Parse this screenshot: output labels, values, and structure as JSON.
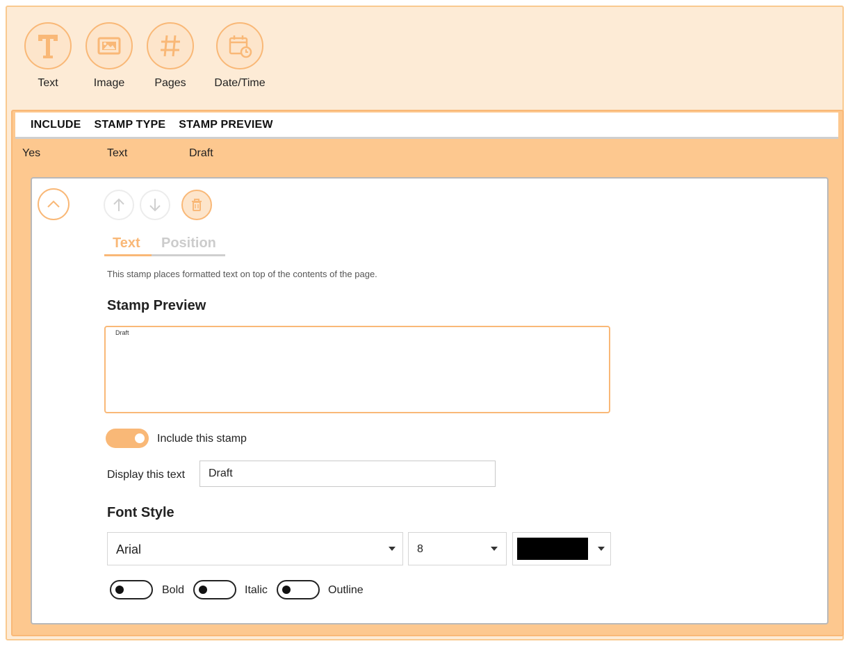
{
  "toolbar": {
    "items": [
      {
        "label": "Text",
        "icon": "text-icon"
      },
      {
        "label": "Image",
        "icon": "image-icon"
      },
      {
        "label": "Pages",
        "icon": "hash-icon"
      },
      {
        "label": "Date/Time",
        "icon": "calendar-clock-icon"
      }
    ]
  },
  "grid": {
    "columns": [
      "INCLUDE",
      "STAMP TYPE",
      "STAMP PREVIEW"
    ],
    "rows": [
      {
        "include": "Yes",
        "type": "Text",
        "preview": "Draft"
      }
    ]
  },
  "editor": {
    "tabs": [
      "Text",
      "Position"
    ],
    "active_tab": "Text",
    "description": "This stamp places formatted text on top of the contents of the page.",
    "preview_title": "Stamp Preview",
    "preview_text": "Draft",
    "include_label": "Include this stamp",
    "include_on": true,
    "display_label": "Display this text",
    "display_value": "Draft",
    "font_title": "Font Style",
    "font_family": "Arial",
    "font_size": "8",
    "font_color": "#000000",
    "bold_label": "Bold",
    "italic_label": "Italic",
    "outline_label": "Outline"
  },
  "colors": {
    "accent": "#f9b877",
    "panel_bg": "#fdc88f",
    "outer_bg": "#fdebd6"
  }
}
